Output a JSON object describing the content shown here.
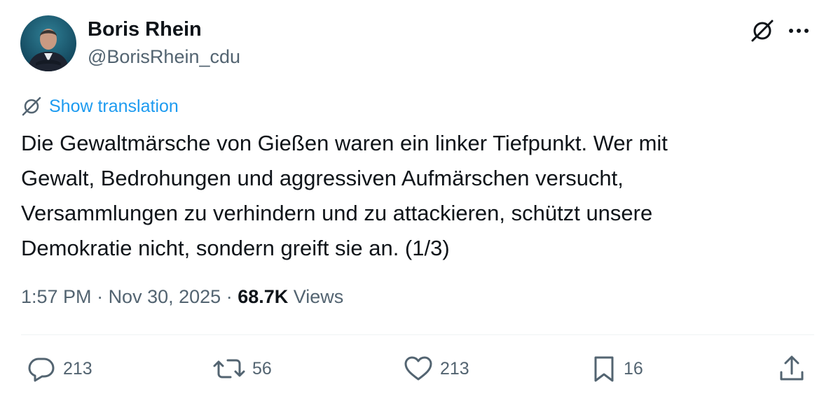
{
  "author": {
    "name": "Boris Rhein",
    "handle": "@BorisRhein_cdu"
  },
  "translation": {
    "label": "Show translation"
  },
  "tweet": {
    "lines": [
      "Die Gewaltmärsche von Gießen waren ein linker Tiefpunkt. Wer mit",
      "Gewalt, Bedrohungen und aggressiven Aufmärschen versucht,",
      "Versammlungen zu verhindern und zu attackieren, schützt unsere",
      "Demokratie nicht, sondern greift sie an. (1/3)"
    ]
  },
  "meta": {
    "time": "1:57 PM",
    "separator": " · ",
    "date": "Nov 30, 2025",
    "views_count": "68.7K",
    "views_label": " Views"
  },
  "actions": {
    "replies": "213",
    "reposts": "56",
    "likes": "213",
    "bookmarks": "16"
  },
  "colors": {
    "link": "#1d9bf0",
    "secondary": "#536471",
    "primary": "#0f1419",
    "divider": "#eff3f4"
  },
  "icons": [
    "grok-icon",
    "more-icon",
    "translate-icon",
    "reply-icon",
    "repost-icon",
    "like-icon",
    "bookmark-icon",
    "share-icon"
  ]
}
